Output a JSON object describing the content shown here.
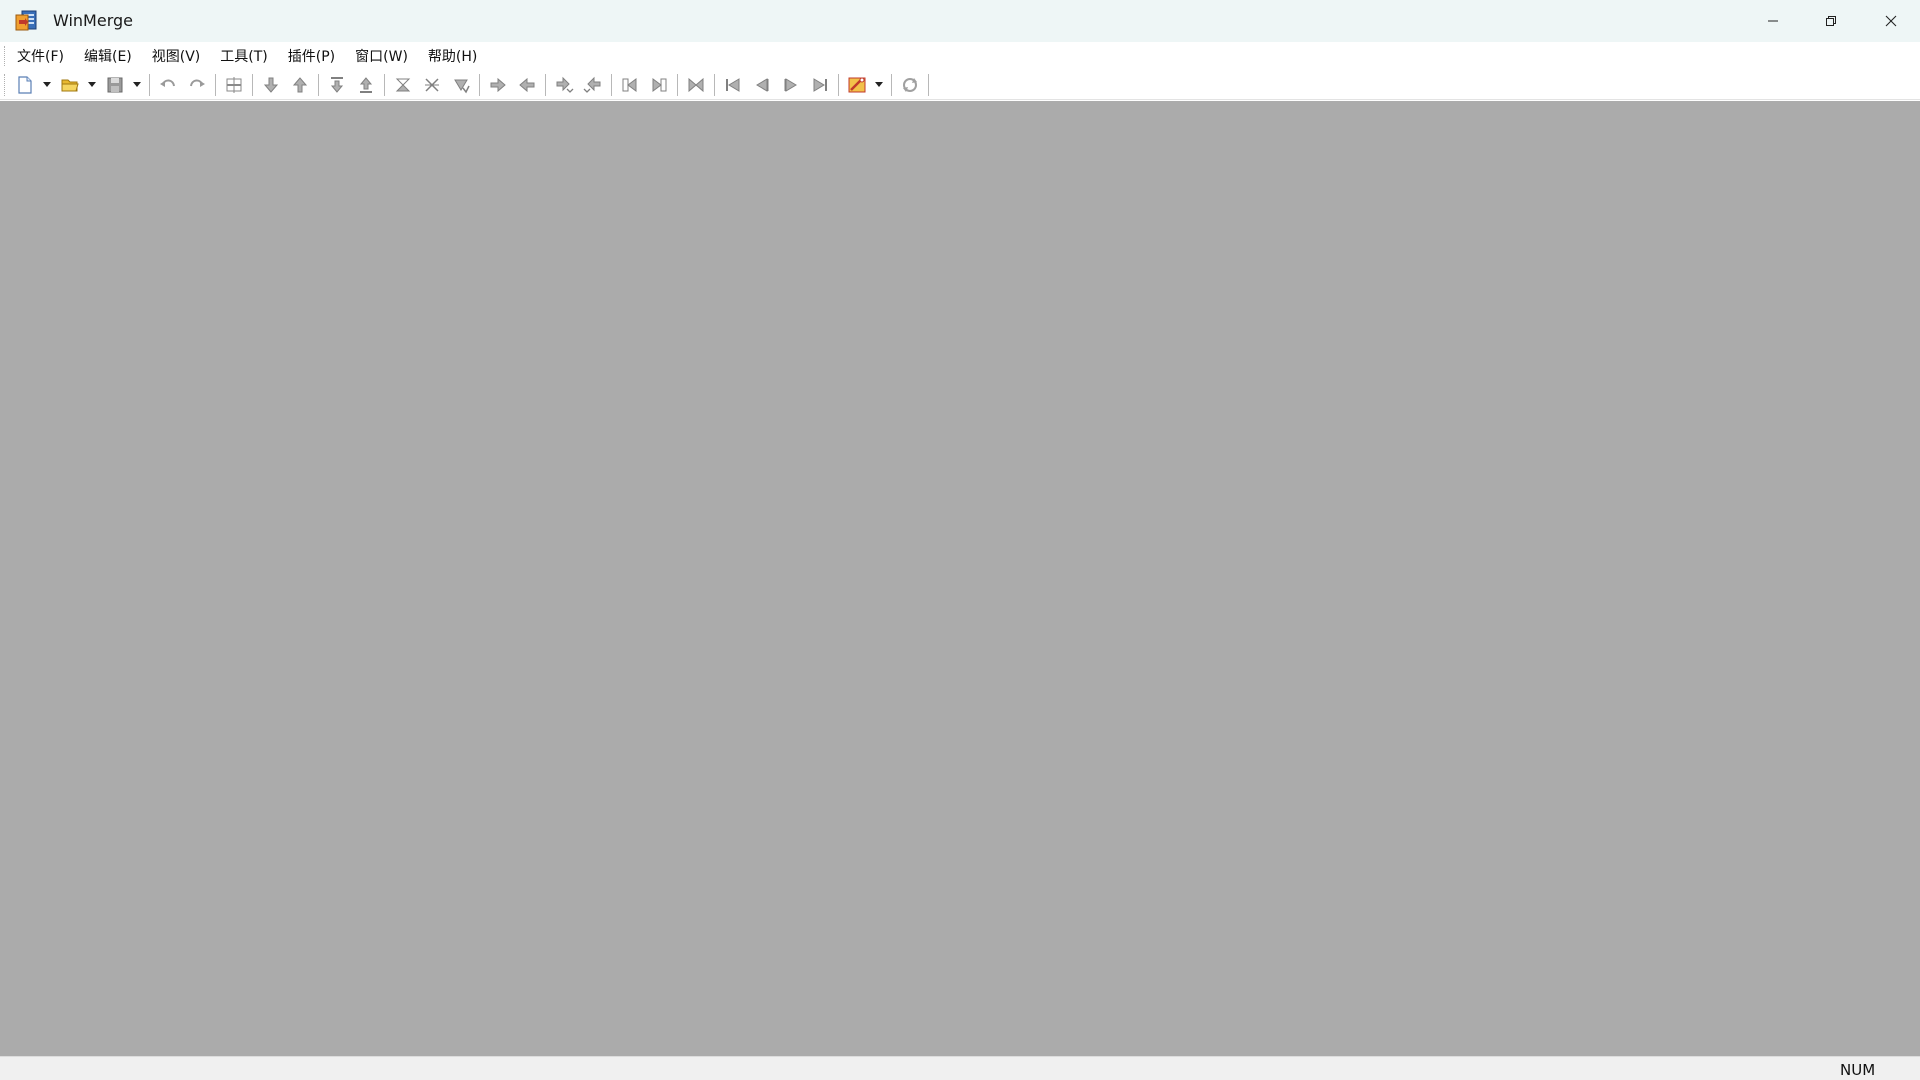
{
  "window": {
    "title": "WinMerge"
  },
  "menu": {
    "items": [
      {
        "label": "文件(F)"
      },
      {
        "label": "编辑(E)"
      },
      {
        "label": "视图(V)"
      },
      {
        "label": "工具(T)"
      },
      {
        "label": "插件(P)"
      },
      {
        "label": "窗口(W)"
      },
      {
        "label": "帮助(H)"
      }
    ]
  },
  "toolbar": {
    "icons": [
      "new-document-icon",
      "open-folder-icon",
      "save-icon",
      "undo-icon",
      "redo-icon",
      "column-compare-icon",
      "next-diff-icon",
      "prev-diff-icon",
      "first-diff-icon",
      "last-diff-icon",
      "copy-right-icon",
      "copy-left-icon",
      "copy-all-icon",
      "merge-right-icon",
      "merge-left-icon",
      "navigate-icon",
      "options-icon",
      "refresh-icon"
    ]
  },
  "status": {
    "num": "NUM"
  },
  "colors": {
    "titlebar": "#eef6f6",
    "client_background": "#ababab",
    "statusbar": "#f0f0f0"
  }
}
